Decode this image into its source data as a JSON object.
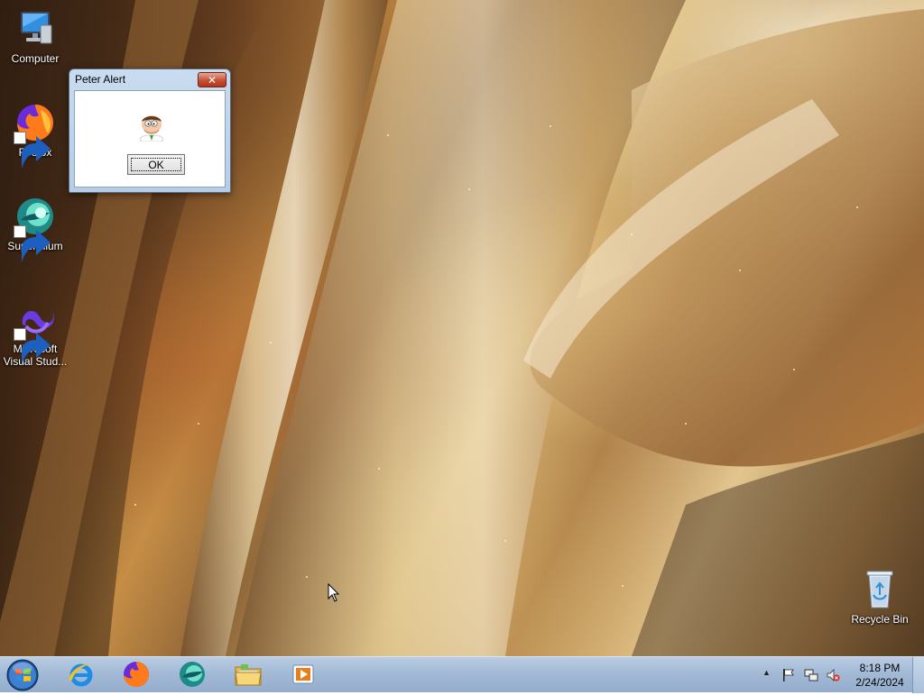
{
  "desktop": {
    "icons": [
      {
        "label": "Computer",
        "icon": "computer-icon"
      },
      {
        "label": "Firefox",
        "icon": "firefox-icon"
      },
      {
        "label": "Supermium",
        "icon": "supermium-icon"
      },
      {
        "label": "Microsoft Visual Stud...",
        "icon": "visual-studio-icon"
      },
      {
        "label": "Recycle Bin",
        "icon": "recycle-bin-icon"
      }
    ]
  },
  "dialog": {
    "title": "Peter Alert",
    "close_label": "✕",
    "icon": "peter-griffin-icon",
    "ok_label": "OK"
  },
  "taskbar": {
    "start_icon": "windows-orb-icon",
    "pinned": [
      {
        "name": "Internet Explorer",
        "icon": "internet-explorer-icon"
      },
      {
        "name": "Firefox",
        "icon": "firefox-icon"
      },
      {
        "name": "Supermium",
        "icon": "supermium-icon"
      },
      {
        "name": "Windows Explorer",
        "icon": "folder-icon"
      },
      {
        "name": "Windows Media Player",
        "icon": "media-player-icon"
      }
    ],
    "tray": {
      "show_hidden": "▲",
      "icons": [
        "action-center-flag-icon",
        "network-icon",
        "volume-muted-icon"
      ],
      "time": "8:18 PM",
      "date": "2/24/2024"
    }
  }
}
